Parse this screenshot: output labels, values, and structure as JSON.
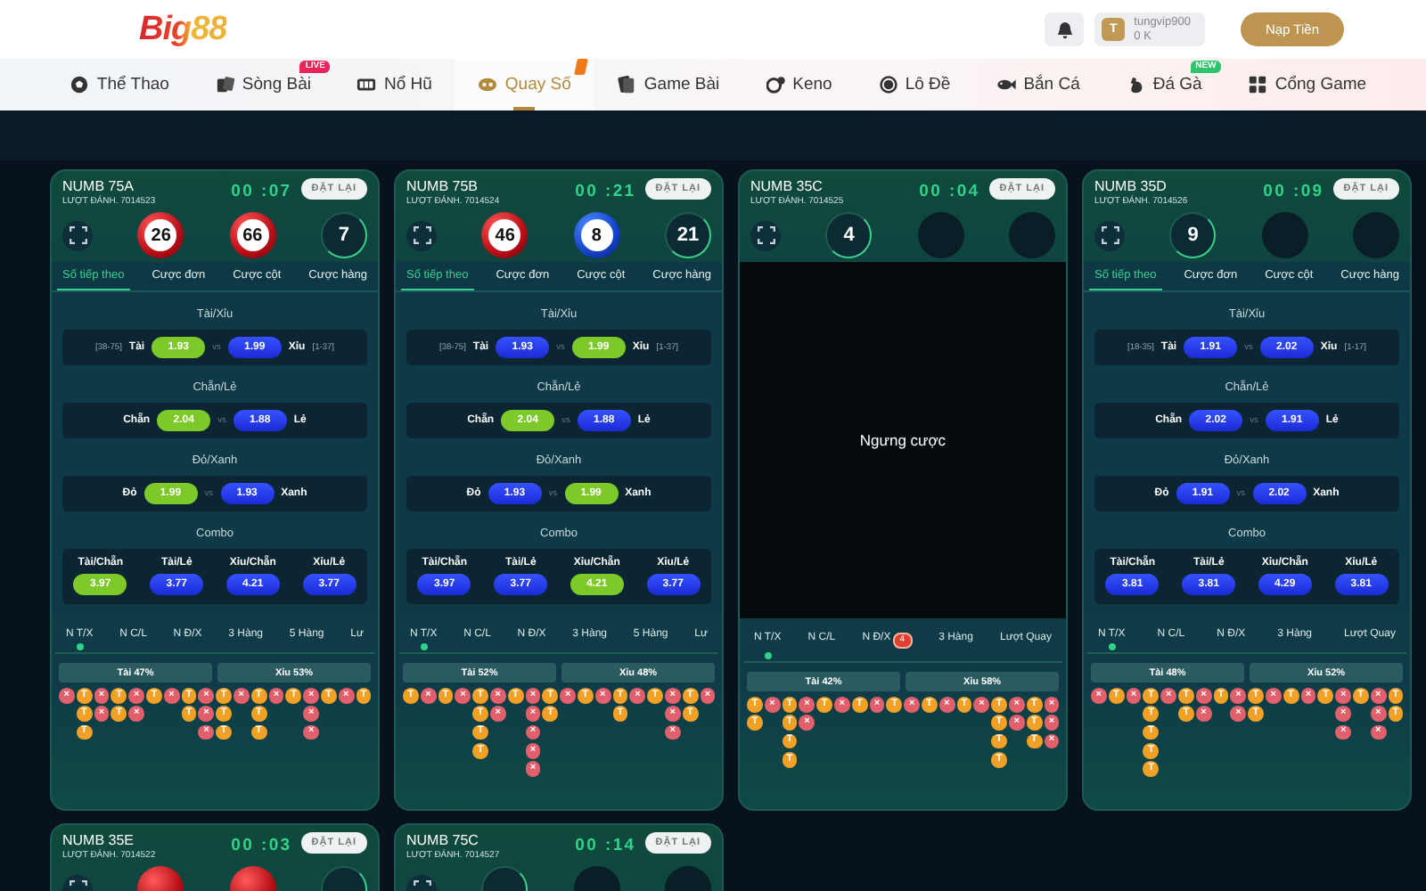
{
  "header": {
    "logo": "Big88",
    "avatar": "T",
    "username": "tungvip900",
    "balance": "0 K",
    "deposit": "Nạp Tiền"
  },
  "nav": [
    {
      "label": "Thể Thao",
      "selected": false
    },
    {
      "label": "Sòng Bài",
      "selected": false,
      "badge": {
        "text": "LIVE",
        "color": "#e8245a"
      }
    },
    {
      "label": "Nổ Hũ",
      "selected": false
    },
    {
      "label": "Quay Số",
      "selected": true,
      "badge": {
        "color": "#f07a1a"
      }
    },
    {
      "label": "Game Bài",
      "selected": false
    },
    {
      "label": "Keno",
      "selected": false
    },
    {
      "label": "Lô Đề",
      "selected": false
    },
    {
      "label": "Bắn Cá",
      "selected": false
    },
    {
      "label": "Đá Gà",
      "selected": false,
      "badge": {
        "text": "NEW",
        "color": "#2ec46b"
      }
    },
    {
      "label": "Cổng Game",
      "selected": false
    }
  ],
  "cards": [
    {
      "name": "NUMB 75A",
      "round": "LƯỢT ĐÁNH. 7014523",
      "timer": "00 :07",
      "reset": "ĐẶT LẠI",
      "suspended": false,
      "balls": [
        {
          "kind": "red",
          "number": "26"
        },
        {
          "kind": "red",
          "number": "66"
        },
        {
          "kind": "ring",
          "number": "7"
        }
      ],
      "tabs": [
        {
          "label": "Số tiếp theo",
          "selected": true
        },
        {
          "label": "Cược đơn",
          "selected": false
        },
        {
          "label": "Cược cột",
          "selected": false
        },
        {
          "label": "Cược hàng",
          "selected": false
        }
      ],
      "markets": [
        {
          "kind": "pair",
          "title": "Tài/Xỉu",
          "left_range": "[38-75]",
          "left_label": "Tài",
          "left_odds": {
            "value": "1.93",
            "highlighted": true
          },
          "vs": "vs",
          "right_odds": {
            "value": "1.99",
            "highlighted": false
          },
          "right_label": "Xỉu",
          "right_range": "[1-37]"
        },
        {
          "kind": "pair",
          "title": "Chẵn/Lẻ",
          "left_label": "Chẵn",
          "left_odds": {
            "value": "2.04",
            "highlighted": true
          },
          "vs": "vs",
          "right_odds": {
            "value": "1.88",
            "highlighted": false
          },
          "right_label": "Lẻ"
        },
        {
          "kind": "pair",
          "title": "Đỏ/Xanh",
          "left_label": "Đỏ",
          "left_odds": {
            "value": "1.99",
            "highlighted": true
          },
          "vs": "vs",
          "right_odds": {
            "value": "1.93",
            "highlighted": false
          },
          "right_label": "Xanh"
        },
        {
          "kind": "combo",
          "title": "Combo",
          "options": [
            {
              "label": "Tài/Chẵn",
              "value": "3.97",
              "highlighted": true
            },
            {
              "label": "Tài/Lẻ",
              "value": "3.77",
              "highlighted": false
            },
            {
              "label": "Xỉu/Chẵn",
              "value": "4.21",
              "highlighted": false
            },
            {
              "label": "Xỉu/Lẻ",
              "value": "3.77",
              "highlighted": false
            }
          ]
        }
      ],
      "stat_tabs": [
        {
          "label": "N T/X",
          "selected": true
        },
        {
          "label": "N C/L",
          "selected": false
        },
        {
          "label": "N Đ/X",
          "selected": false
        },
        {
          "label": "3 Hàng",
          "selected": false
        },
        {
          "label": "5 Hàng",
          "selected": false
        },
        {
          "label": "Lư",
          "selected": false
        }
      ],
      "split": [
        "Tài 47%",
        "Xỉu 53%"
      ],
      "road": [
        [
          {
            "kind": "xiu",
            "label": "×"
          }
        ],
        [
          {
            "kind": "tai",
            "label": "T"
          },
          {
            "kind": "tai",
            "label": "T"
          },
          {
            "kind": "tai",
            "label": "T"
          }
        ],
        [
          {
            "kind": "xiu",
            "label": "×"
          },
          {
            "kind": "xiu",
            "label": "×"
          }
        ],
        [
          {
            "kind": "tai",
            "label": "T"
          },
          {
            "kind": "tai",
            "label": "T"
          }
        ],
        [
          {
            "kind": "xiu",
            "label": "×"
          },
          {
            "kind": "xiu",
            "label": "×"
          }
        ],
        [
          {
            "kind": "tai",
            "label": "T"
          }
        ],
        [
          {
            "kind": "xiu",
            "label": "×"
          }
        ],
        [
          {
            "kind": "tai",
            "label": "T"
          },
          {
            "kind": "tai",
            "label": "T"
          }
        ],
        [
          {
            "kind": "xiu",
            "label": "×"
          },
          {
            "kind": "xiu",
            "label": "×"
          },
          {
            "kind": "xiu",
            "label": "×"
          }
        ],
        [
          {
            "kind": "tai",
            "label": "T"
          },
          {
            "kind": "tai",
            "label": "T"
          },
          {
            "kind": "tai",
            "label": "T"
          }
        ],
        [
          {
            "kind": "xiu",
            "label": "×"
          }
        ],
        [
          {
            "kind": "tai",
            "label": "T"
          },
          {
            "kind": "tai",
            "label": "T"
          },
          {
            "kind": "tai",
            "label": "T"
          }
        ],
        [
          {
            "kind": "xiu",
            "label": "×"
          }
        ],
        [
          {
            "kind": "tai",
            "label": "T"
          }
        ],
        [
          {
            "kind": "xiu",
            "label": "×"
          },
          {
            "kind": "xiu",
            "label": "×"
          },
          {
            "kind": "xiu",
            "label": "×"
          }
        ],
        [
          {
            "kind": "tai",
            "label": "T"
          }
        ],
        [
          {
            "kind": "xiu",
            "label": "×"
          }
        ],
        [
          {
            "kind": "tai",
            "label": "T"
          }
        ]
      ]
    },
    {
      "name": "NUMB 75B",
      "round": "LƯỢT ĐÁNH. 7014524",
      "timer": "00 :21",
      "reset": "ĐẶT LẠI",
      "suspended": false,
      "balls": [
        {
          "kind": "red",
          "number": "46"
        },
        {
          "kind": "blue",
          "number": "8"
        },
        {
          "kind": "ring",
          "number": "21"
        }
      ],
      "tabs": [
        {
          "label": "Số tiếp theo",
          "selected": true
        },
        {
          "label": "Cược đơn",
          "selected": false
        },
        {
          "label": "Cược cột",
          "selected": false
        },
        {
          "label": "Cược hàng",
          "selected": false
        }
      ],
      "markets": [
        {
          "kind": "pair",
          "title": "Tài/Xỉu",
          "left_range": "[38-75]",
          "left_label": "Tài",
          "left_odds": {
            "value": "1.93",
            "highlighted": false
          },
          "vs": "vs",
          "right_odds": {
            "value": "1.99",
            "highlighted": true
          },
          "right_label": "Xỉu",
          "right_range": "[1-37]"
        },
        {
          "kind": "pair",
          "title": "Chẵn/Lẻ",
          "left_label": "Chẵn",
          "left_odds": {
            "value": "2.04",
            "highlighted": true
          },
          "vs": "vs",
          "right_odds": {
            "value": "1.88",
            "highlighted": false
          },
          "right_label": "Lẻ"
        },
        {
          "kind": "pair",
          "title": "Đỏ/Xanh",
          "left_label": "Đỏ",
          "left_odds": {
            "value": "1.93",
            "highlighted": false
          },
          "vs": "vs",
          "right_odds": {
            "value": "1.99",
            "highlighted": true
          },
          "right_label": "Xanh"
        },
        {
          "kind": "combo",
          "title": "Combo",
          "options": [
            {
              "label": "Tài/Chẵn",
              "value": "3.97",
              "highlighted": false
            },
            {
              "label": "Tài/Lẻ",
              "value": "3.77",
              "highlighted": false
            },
            {
              "label": "Xỉu/Chẵn",
              "value": "4.21",
              "highlighted": true
            },
            {
              "label": "Xỉu/Lẻ",
              "value": "3.77",
              "highlighted": false
            }
          ]
        }
      ],
      "stat_tabs": [
        {
          "label": "N T/X",
          "selected": true
        },
        {
          "label": "N C/L",
          "selected": false
        },
        {
          "label": "N Đ/X",
          "selected": false
        },
        {
          "label": "3 Hàng",
          "selected": false
        },
        {
          "label": "5 Hàng",
          "selected": false
        },
        {
          "label": "Lư",
          "selected": false
        }
      ],
      "split": [
        "Tài 52%",
        "Xỉu 48%"
      ],
      "road": [
        [
          {
            "kind": "tai",
            "label": "T"
          }
        ],
        [
          {
            "kind": "xiu",
            "label": "×"
          }
        ],
        [
          {
            "kind": "tai",
            "label": "T"
          }
        ],
        [
          {
            "kind": "xiu",
            "label": "×"
          }
        ],
        [
          {
            "kind": "tai",
            "label": "T"
          },
          {
            "kind": "tai",
            "label": "T"
          },
          {
            "kind": "tai",
            "label": "T"
          },
          {
            "kind": "tai",
            "label": "T"
          }
        ],
        [
          {
            "kind": "xiu",
            "label": "×"
          },
          {
            "kind": "xiu",
            "label": "×"
          }
        ],
        [
          {
            "kind": "tai",
            "label": "T"
          }
        ],
        [
          {
            "kind": "xiu",
            "label": "×"
          },
          {
            "kind": "xiu",
            "label": "×"
          },
          {
            "kind": "xiu",
            "label": "×"
          },
          {
            "kind": "xiu",
            "label": "×"
          },
          {
            "kind": "xiu",
            "label": "×"
          }
        ],
        [
          {
            "kind": "tai",
            "label": "T"
          },
          {
            "kind": "tai",
            "label": "T"
          }
        ],
        [
          {
            "kind": "xiu",
            "label": "×"
          }
        ],
        [
          {
            "kind": "tai",
            "label": "T"
          }
        ],
        [
          {
            "kind": "xiu",
            "label": "×"
          }
        ],
        [
          {
            "kind": "tai",
            "label": "T"
          },
          {
            "kind": "tai",
            "label": "T"
          }
        ],
        [
          {
            "kind": "xiu",
            "label": "×"
          }
        ],
        [
          {
            "kind": "tai",
            "label": "T"
          }
        ],
        [
          {
            "kind": "xiu",
            "label": "×"
          },
          {
            "kind": "xiu",
            "label": "×"
          },
          {
            "kind": "xiu",
            "label": "×"
          }
        ],
        [
          {
            "kind": "tai",
            "label": "T"
          },
          {
            "kind": "tai",
            "label": "T"
          }
        ],
        [
          {
            "kind": "xiu",
            "label": "×"
          }
        ]
      ]
    },
    {
      "name": "NUMB 35C",
      "round": "LƯỢT ĐÁNH. 7014525",
      "timer": "00 :04",
      "reset": "ĐẶT LẠI",
      "suspended": true,
      "suspended_text": "Ngưng cược",
      "balls": [
        {
          "kind": "ring",
          "number": "4"
        },
        {
          "kind": "empty"
        },
        {
          "kind": "empty"
        }
      ],
      "stat_tabs": [
        {
          "label": "N T/X",
          "selected": true
        },
        {
          "label": "N C/L",
          "selected": false
        },
        {
          "label": "N Đ/X",
          "selected": false,
          "badge": "4"
        },
        {
          "label": "3 Hàng",
          "selected": false
        },
        {
          "label": "Lượt Quay",
          "selected": false
        }
      ],
      "split": [
        "Tài 42%",
        "Xỉu 58%"
      ],
      "road": [
        [
          {
            "kind": "tai",
            "label": "T"
          },
          {
            "kind": "tai",
            "label": "T"
          }
        ],
        [
          {
            "kind": "xiu",
            "label": "×"
          }
        ],
        [
          {
            "kind": "tai",
            "label": "T"
          },
          {
            "kind": "tai",
            "label": "T"
          },
          {
            "kind": "tai",
            "label": "T"
          },
          {
            "kind": "tai",
            "label": "T"
          }
        ],
        [
          {
            "kind": "xiu",
            "label": "×"
          },
          {
            "kind": "xiu",
            "label": "×"
          }
        ],
        [
          {
            "kind": "tai",
            "label": "T"
          }
        ],
        [
          {
            "kind": "xiu",
            "label": "×"
          }
        ],
        [
          {
            "kind": "tai",
            "label": "T"
          }
        ],
        [
          {
            "kind": "xiu",
            "label": "×"
          }
        ],
        [
          {
            "kind": "tai",
            "label": "T"
          }
        ],
        [
          {
            "kind": "xiu",
            "label": "×"
          }
        ],
        [
          {
            "kind": "tai",
            "label": "T"
          }
        ],
        [
          {
            "kind": "xiu",
            "label": "×"
          }
        ],
        [
          {
            "kind": "tai",
            "label": "T"
          }
        ],
        [
          {
            "kind": "xiu",
            "label": "×"
          }
        ],
        [
          {
            "kind": "tai",
            "label": "T"
          },
          {
            "kind": "tai",
            "label": "T"
          },
          {
            "kind": "tai",
            "label": "T"
          },
          {
            "kind": "tai",
            "label": "T"
          }
        ],
        [
          {
            "kind": "xiu",
            "label": "×"
          },
          {
            "kind": "xiu",
            "label": "×"
          }
        ],
        [
          {
            "kind": "tai",
            "label": "T"
          },
          {
            "kind": "tai",
            "label": "T"
          },
          {
            "kind": "tai",
            "label": "T"
          }
        ],
        [
          {
            "kind": "xiu",
            "label": "×"
          },
          {
            "kind": "xiu",
            "label": "×"
          },
          {
            "kind": "xiu",
            "label": "×"
          }
        ]
      ]
    },
    {
      "name": "NUMB 35D",
      "round": "LƯỢT ĐÁNH. 7014526",
      "timer": "00 :09",
      "reset": "ĐẶT LẠI",
      "suspended": false,
      "balls": [
        {
          "kind": "ring",
          "number": "9"
        },
        {
          "kind": "empty"
        },
        {
          "kind": "empty"
        }
      ],
      "tabs": [
        {
          "label": "Số tiếp theo",
          "selected": true
        },
        {
          "label": "Cược đơn",
          "selected": false
        },
        {
          "label": "Cược cột",
          "selected": false
        },
        {
          "label": "Cược hàng",
          "selected": false
        }
      ],
      "markets": [
        {
          "kind": "pair",
          "title": "Tài/Xỉu",
          "left_range": "[18-35]",
          "left_label": "Tài",
          "left_odds": {
            "value": "1.91",
            "highlighted": false
          },
          "vs": "vs",
          "right_odds": {
            "value": "2.02",
            "highlighted": false
          },
          "right_label": "Xỉu",
          "right_range": "[1-17]"
        },
        {
          "kind": "pair",
          "title": "Chẵn/Lẻ",
          "left_label": "Chẵn",
          "left_odds": {
            "value": "2.02",
            "highlighted": false
          },
          "vs": "vs",
          "right_odds": {
            "value": "1.91",
            "highlighted": false
          },
          "right_label": "Lẻ"
        },
        {
          "kind": "pair",
          "title": "Đỏ/Xanh",
          "left_label": "Đỏ",
          "left_odds": {
            "value": "1.91",
            "highlighted": false
          },
          "vs": "vs",
          "right_odds": {
            "value": "2.02",
            "highlighted": false
          },
          "right_label": "Xanh"
        },
        {
          "kind": "combo",
          "title": "Combo",
          "options": [
            {
              "label": "Tài/Chẵn",
              "value": "3.81",
              "highlighted": false
            },
            {
              "label": "Tài/Lẻ",
              "value": "3.81",
              "highlighted": false
            },
            {
              "label": "Xỉu/Chẵn",
              "value": "4.29",
              "highlighted": false
            },
            {
              "label": "Xỉu/Lẻ",
              "value": "3.81",
              "highlighted": false
            }
          ]
        }
      ],
      "stat_tabs": [
        {
          "label": "N T/X",
          "selected": true
        },
        {
          "label": "N C/L",
          "selected": false
        },
        {
          "label": "N Đ/X",
          "selected": false
        },
        {
          "label": "3 Hàng",
          "selected": false
        },
        {
          "label": "Lượt Quay",
          "selected": false
        }
      ],
      "split": [
        "Tài 48%",
        "Xỉu 52%"
      ],
      "road": [
        [
          {
            "kind": "xiu",
            "label": "×"
          }
        ],
        [
          {
            "kind": "tai",
            "label": "T"
          }
        ],
        [
          {
            "kind": "xiu",
            "label": "×"
          }
        ],
        [
          {
            "kind": "tai",
            "label": "T"
          },
          {
            "kind": "tai",
            "label": "T"
          },
          {
            "kind": "tai",
            "label": "T"
          },
          {
            "kind": "tai",
            "label": "T"
          },
          {
            "kind": "tai",
            "label": "T"
          }
        ],
        [
          {
            "kind": "xiu",
            "label": "×"
          }
        ],
        [
          {
            "kind": "tai",
            "label": "T"
          },
          {
            "kind": "tai",
            "label": "T"
          }
        ],
        [
          {
            "kind": "xiu",
            "label": "×"
          },
          {
            "kind": "xiu",
            "label": "×"
          }
        ],
        [
          {
            "kind": "tai",
            "label": "T"
          }
        ],
        [
          {
            "kind": "xiu",
            "label": "×"
          },
          {
            "kind": "xiu",
            "label": "×"
          }
        ],
        [
          {
            "kind": "tai",
            "label": "T"
          },
          {
            "kind": "tai",
            "label": "T"
          }
        ],
        [
          {
            "kind": "xiu",
            "label": "×"
          }
        ],
        [
          {
            "kind": "tai",
            "label": "T"
          }
        ],
        [
          {
            "kind": "xiu",
            "label": "×"
          }
        ],
        [
          {
            "kind": "tai",
            "label": "T"
          }
        ],
        [
          {
            "kind": "xiu",
            "label": "×"
          },
          {
            "kind": "xiu",
            "label": "×"
          },
          {
            "kind": "xiu",
            "label": "×"
          }
        ],
        [
          {
            "kind": "tai",
            "label": "T"
          }
        ],
        [
          {
            "kind": "xiu",
            "label": "×"
          },
          {
            "kind": "xiu",
            "label": "×"
          },
          {
            "kind": "xiu",
            "label": "×"
          }
        ],
        [
          {
            "kind": "tai",
            "label": "T"
          },
          {
            "kind": "tai",
            "label": "T"
          }
        ]
      ]
    },
    {
      "name": "NUMB 35E",
      "round": "LƯỢT ĐÁNH. 7014522",
      "timer": "00 :03",
      "reset": "ĐẶT LẠI",
      "suspended": false,
      "balls": [
        {
          "kind": "red"
        },
        {
          "kind": "red"
        },
        {
          "kind": "ring"
        }
      ]
    },
    {
      "name": "NUMB 75C",
      "round": "LƯỢT ĐÁNH. 7014527",
      "timer": "00 :14",
      "reset": "ĐẶT LẠI",
      "suspended": false,
      "balls": [
        {
          "kind": "ring"
        },
        {
          "kind": "empty"
        },
        {
          "kind": "empty"
        }
      ]
    }
  ]
}
